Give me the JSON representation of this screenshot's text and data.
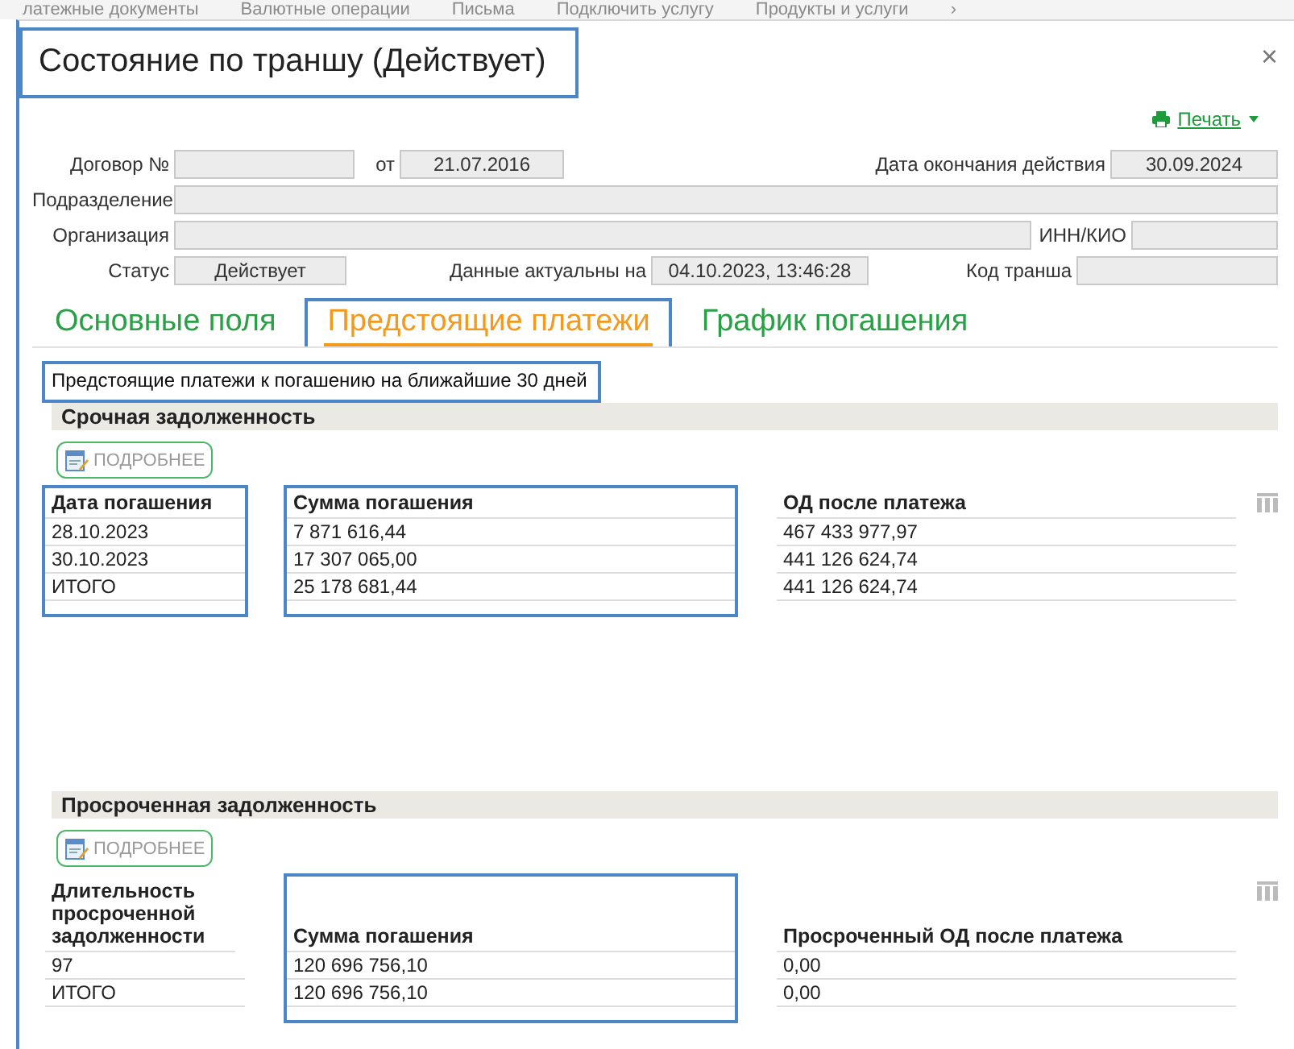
{
  "background_menu": [
    "латежные документы",
    "Валютные операции",
    "Письма",
    "Подключить услугу",
    "Продукты и услуги",
    "›"
  ],
  "dialog": {
    "title": "Состояние по траншу (Действует)",
    "title_highlighted": true,
    "close": "×",
    "print": "Печать"
  },
  "form": {
    "contract_label": "Договор №",
    "from_label": "от",
    "from_value": "21.07.2016",
    "end_label": "Дата окончания действия",
    "end_value": "30.09.2024",
    "division_label": "Подразделение",
    "org_label": "Организация",
    "inn_label": "ИНН/КИО",
    "status_label": "Статус",
    "status_value": "Действует",
    "actual_label": "Данные актуальны на",
    "actual_value": "04.10.2023, 13:46:28",
    "code_label": "Код транша"
  },
  "tabs": [
    {
      "label": "Основные поля",
      "selected": false,
      "highlighted": false
    },
    {
      "label": "Предстоящие платежи",
      "selected": true,
      "highlighted": true
    },
    {
      "label": "График погашения",
      "selected": false,
      "highlighted": false
    }
  ],
  "note": {
    "text": "Предстоящие платежи к погашению на ближайшие 30 дней",
    "highlighted": true
  },
  "sections": [
    {
      "title": "Срочная задолженность",
      "button": "ПОДРОБНЕЕ",
      "columns": [
        {
          "header": "Дата погашения",
          "highlighted": true
        },
        {
          "header": "Сумма погашения",
          "highlighted": true
        },
        {
          "header": "ОД после платежа",
          "highlighted": false
        }
      ],
      "rows": [
        [
          "28.10.2023",
          "7 871 616,44",
          "467 433 977,97"
        ],
        [
          "30.10.2023",
          "17 307 065,00",
          "441 126 624,74"
        ],
        [
          "ИТОГО",
          "25 178 681,44",
          "441 126 624,74"
        ]
      ]
    },
    {
      "title": "Просроченная задолженность",
      "button": "ПОДРОБНЕЕ",
      "columns": [
        {
          "header": "Длительность просроченной задолженности",
          "highlighted": false
        },
        {
          "header": "Сумма погашения",
          "highlighted": true
        },
        {
          "header": "Просроченный ОД после платежа",
          "highlighted": false
        }
      ],
      "rows": [
        [
          "97",
          "120 696 756,10",
          "0,00"
        ],
        [
          "ИТОГО",
          "120 696 756,10",
          "0,00"
        ]
      ]
    }
  ]
}
